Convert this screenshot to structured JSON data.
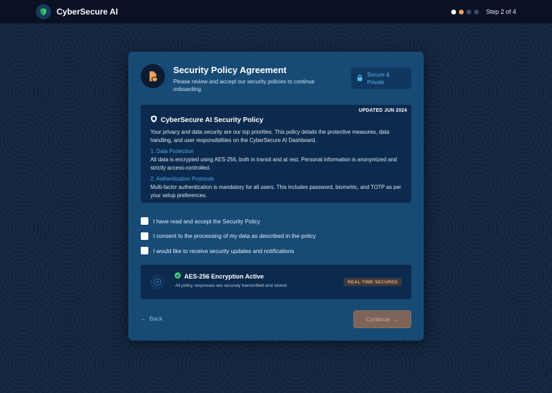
{
  "app": {
    "title": "CyberSecure AI"
  },
  "progress": {
    "step_text": "Step 2 of 4",
    "current_step": 2,
    "total_steps": 4
  },
  "card": {
    "title": "Security Policy Agreement",
    "subtitle": "Please review and accept our security policies to continue onboarding.",
    "badge_label": "Secure & Private"
  },
  "policy": {
    "updated": "UPDATED JUN 2024",
    "title": "CyberSecure AI Security Policy",
    "intro": "Your privacy and data security are our top priorities. This policy details the protective measures, data handling, and user responsibilities on the CyberSecure AI Dashboard.",
    "sections": [
      {
        "heading": "1. Data Protection",
        "body": "All data is encrypted using AES-256, both in transit and at rest. Personal information is anonymized and strictly access-controlled."
      },
      {
        "heading": "2. Authentication Protocols",
        "body": "Multi-factor authentication is mandatory for all users. This includes password, biometric, and TOTP as per your setup preferences."
      }
    ]
  },
  "checkboxes": [
    {
      "label": "I have read and accept the Security Policy",
      "checked": false
    },
    {
      "label": "I consent to the processing of my data as described in the policy",
      "checked": false
    },
    {
      "label": "I would like to receive security updates and notifications",
      "checked": false
    }
  ],
  "encryption": {
    "title": "AES-256 Encryption Active",
    "subtitle": "All policy responses are securely transmitted and stored.",
    "badge": "REAL-TIME SECURED"
  },
  "nav": {
    "back_label": "Back",
    "continue_label": "Continue"
  },
  "colors": {
    "accent": "#f0a35c",
    "card": "#174a74",
    "link": "#4aa9e8",
    "success": "#3ccf6e"
  },
  "icons": [
    "shield-icon",
    "document-icon",
    "lock-icon",
    "check-circle-icon",
    "scan-icon",
    "arrow-left-icon",
    "arrow-right-icon"
  ]
}
